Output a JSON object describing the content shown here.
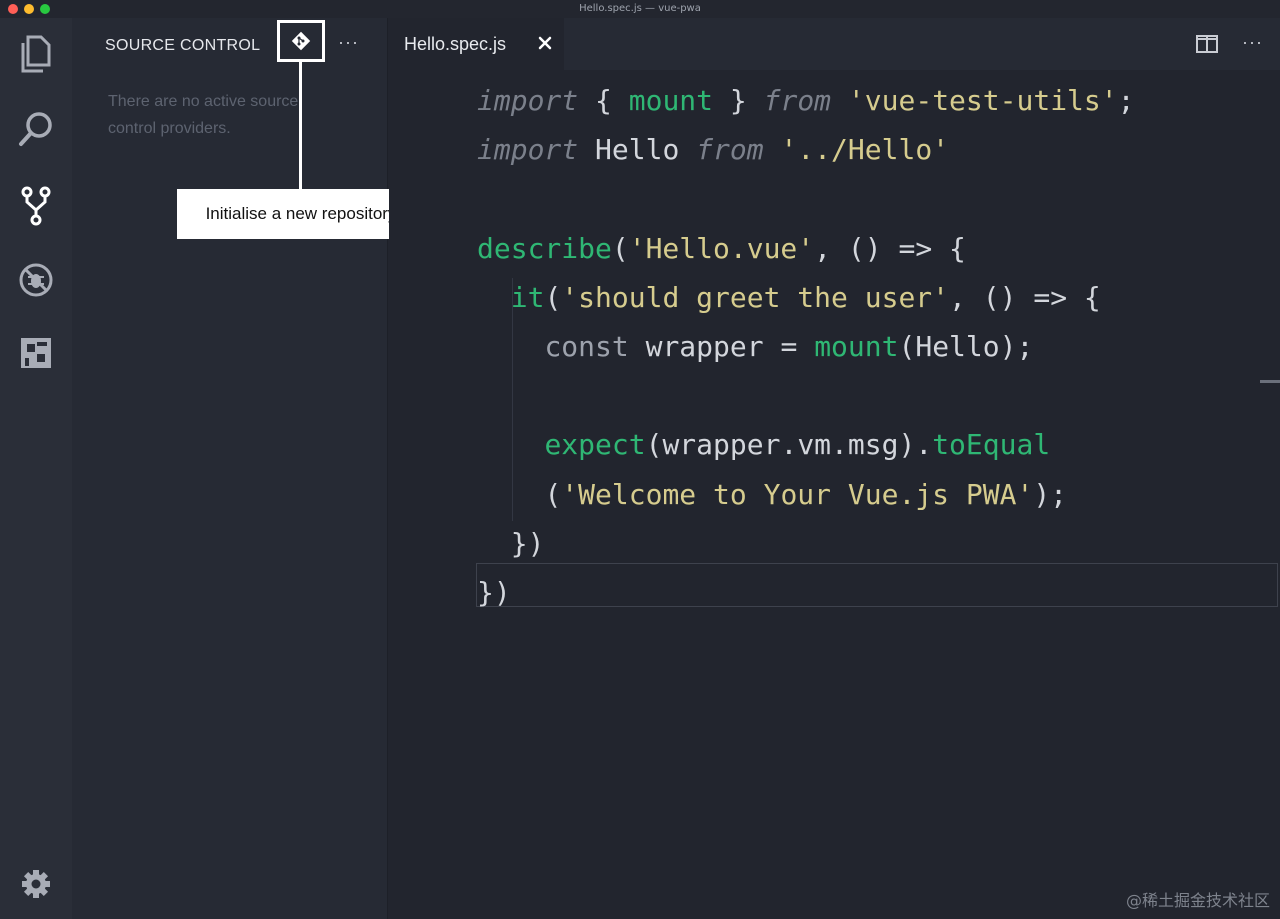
{
  "window": {
    "title": "Hello.spec.js — vue-pwa"
  },
  "activity_bar": {
    "items": [
      {
        "icon": "files-icon"
      },
      {
        "icon": "search-icon"
      },
      {
        "icon": "source-control-icon"
      },
      {
        "icon": "debug-icon"
      },
      {
        "icon": "extensions-icon"
      }
    ],
    "bottom_icon": "gear-icon"
  },
  "sidebar": {
    "title": "SOURCE CONTROL",
    "more_label": "···",
    "message": "There are no active source control providers.",
    "git_button_icon": "git-init-icon",
    "callout_text": "Initialise a new repository"
  },
  "editor": {
    "tab_label": "Hello.spec.js",
    "close_icon": "close-icon",
    "split_icon": "split-editor-icon",
    "more_label": "···",
    "code_lines": [
      "import { mount } from 'vue-test-utils';",
      "import Hello from '../Hello'",
      "",
      "describe('Hello.vue', () => {",
      "  it('should greet the user', () => {",
      "    const wrapper = mount(Hello);",
      "",
      "    expect(wrapper.vm.msg).toEqual",
      "    ('Welcome to Your Vue.js PWA');",
      "  })",
      "})"
    ]
  },
  "watermark": "@稀土掘金技术社区",
  "colors": {
    "background": "#22252e",
    "sidebar": "#262a34",
    "activity_bar": "#2a2e38",
    "keyword": "#7b808b",
    "string": "#d6cc8e",
    "function": "#2fb774",
    "text": "#d3d6dc"
  }
}
